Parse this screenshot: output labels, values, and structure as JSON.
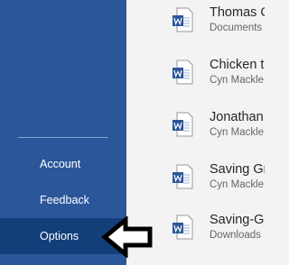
{
  "sidebar": {
    "background": "#2b579a",
    "selected_background": "#123f7a",
    "items": [
      {
        "label": "Account"
      },
      {
        "label": "Feedback"
      },
      {
        "label": "Options"
      }
    ]
  },
  "files": [
    {
      "name": "Thomas C",
      "location": "Documents",
      "icon": "word-document-icon"
    },
    {
      "name": "Chicken t",
      "location": "Cyn Mackle",
      "icon": "word-document-icon"
    },
    {
      "name": "Jonathan",
      "location": "Cyn Mackle",
      "icon": "word-document-icon"
    },
    {
      "name": "Saving Gr",
      "location": "Cyn Mackle",
      "icon": "word-document-icon"
    },
    {
      "name": "Saving-G",
      "location": "Downloads",
      "icon": "word-document-icon"
    }
  ],
  "annotation": {
    "icon": "left-arrow-icon"
  }
}
